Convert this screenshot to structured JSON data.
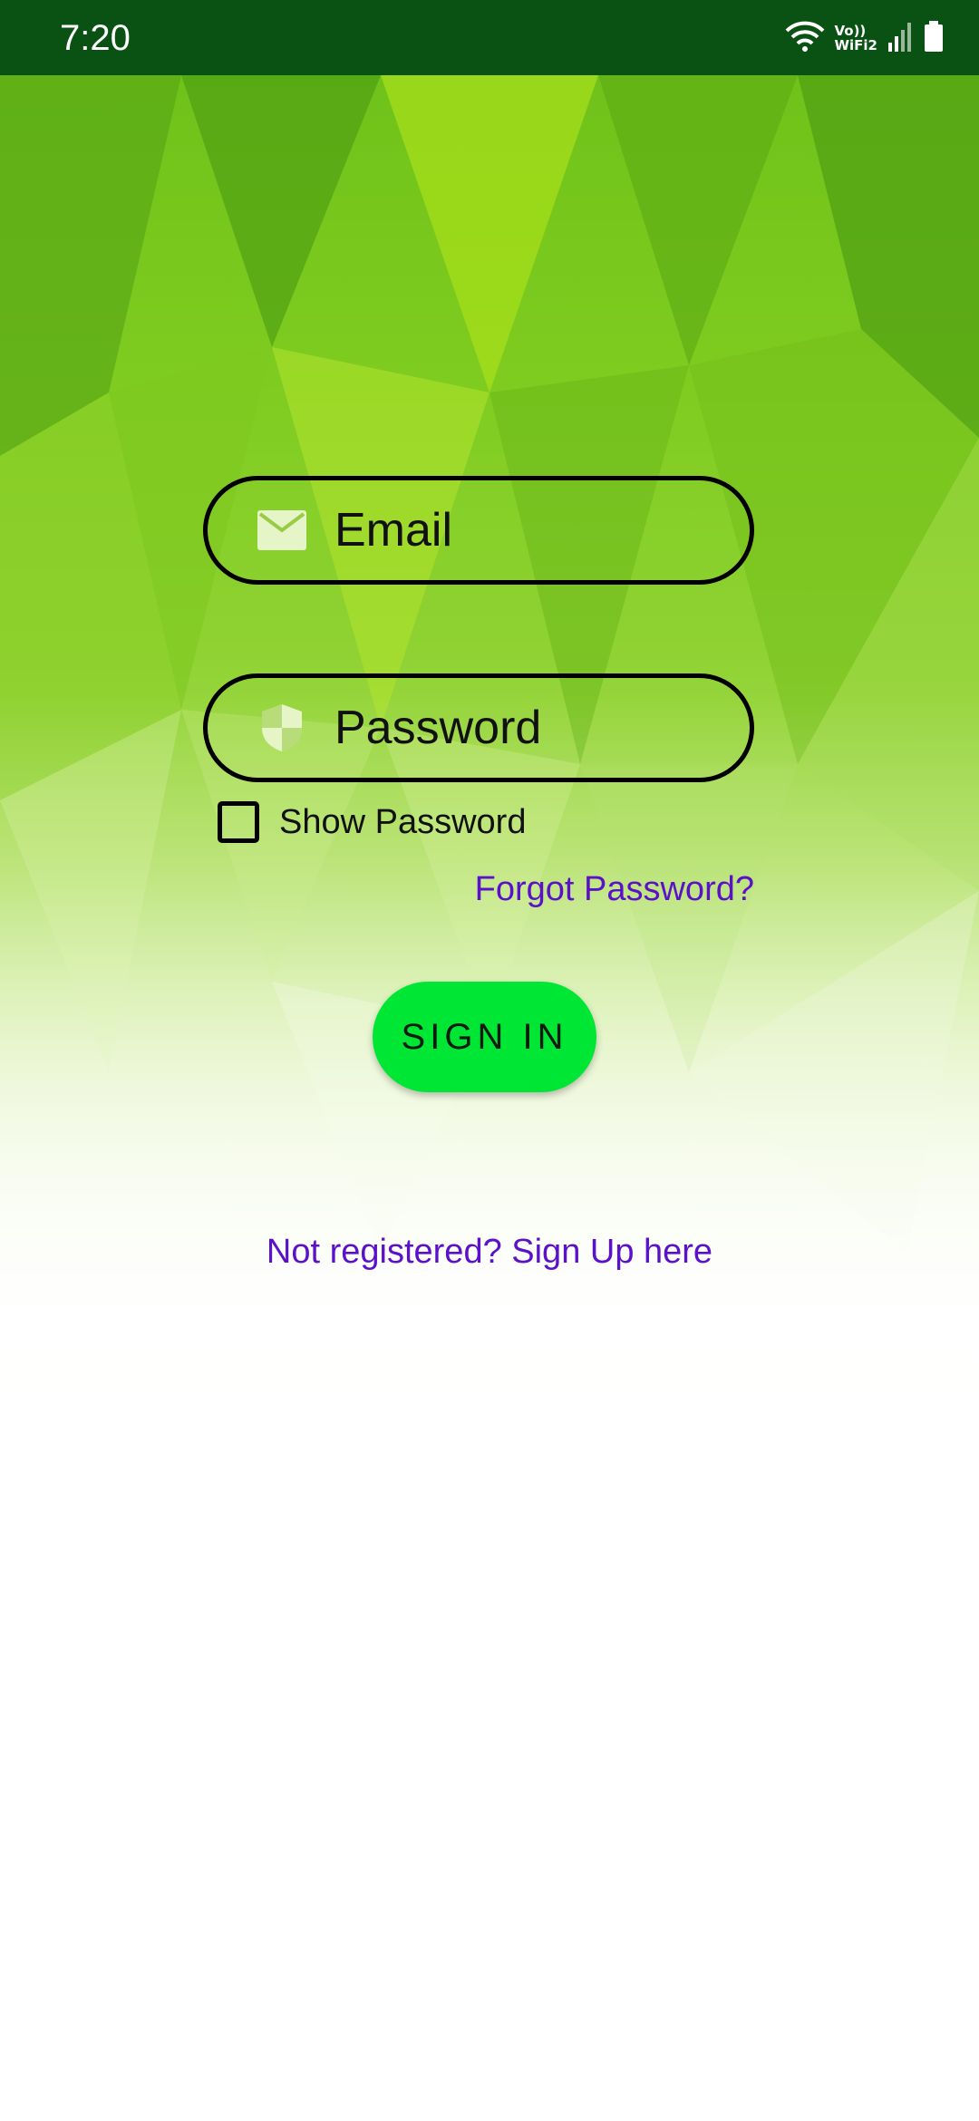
{
  "status_bar": {
    "time": "7:20",
    "wifi_label_line1": "Vo))",
    "wifi_label_line2": "WiFi2",
    "icons": [
      "wifi-icon",
      "signal-icon",
      "battery-icon"
    ]
  },
  "login": {
    "email_placeholder": "Email",
    "password_placeholder": "Password",
    "show_password_label": "Show Password",
    "forgot_password": "Forgot Password?",
    "sign_in": "SIGN IN",
    "sign_up_link": "Not registered? Sign Up here"
  },
  "colors": {
    "status_bar": "#0a5214",
    "accent_button": "#00e635",
    "link": "#5a11c9",
    "background_green": "#7fcc20"
  }
}
